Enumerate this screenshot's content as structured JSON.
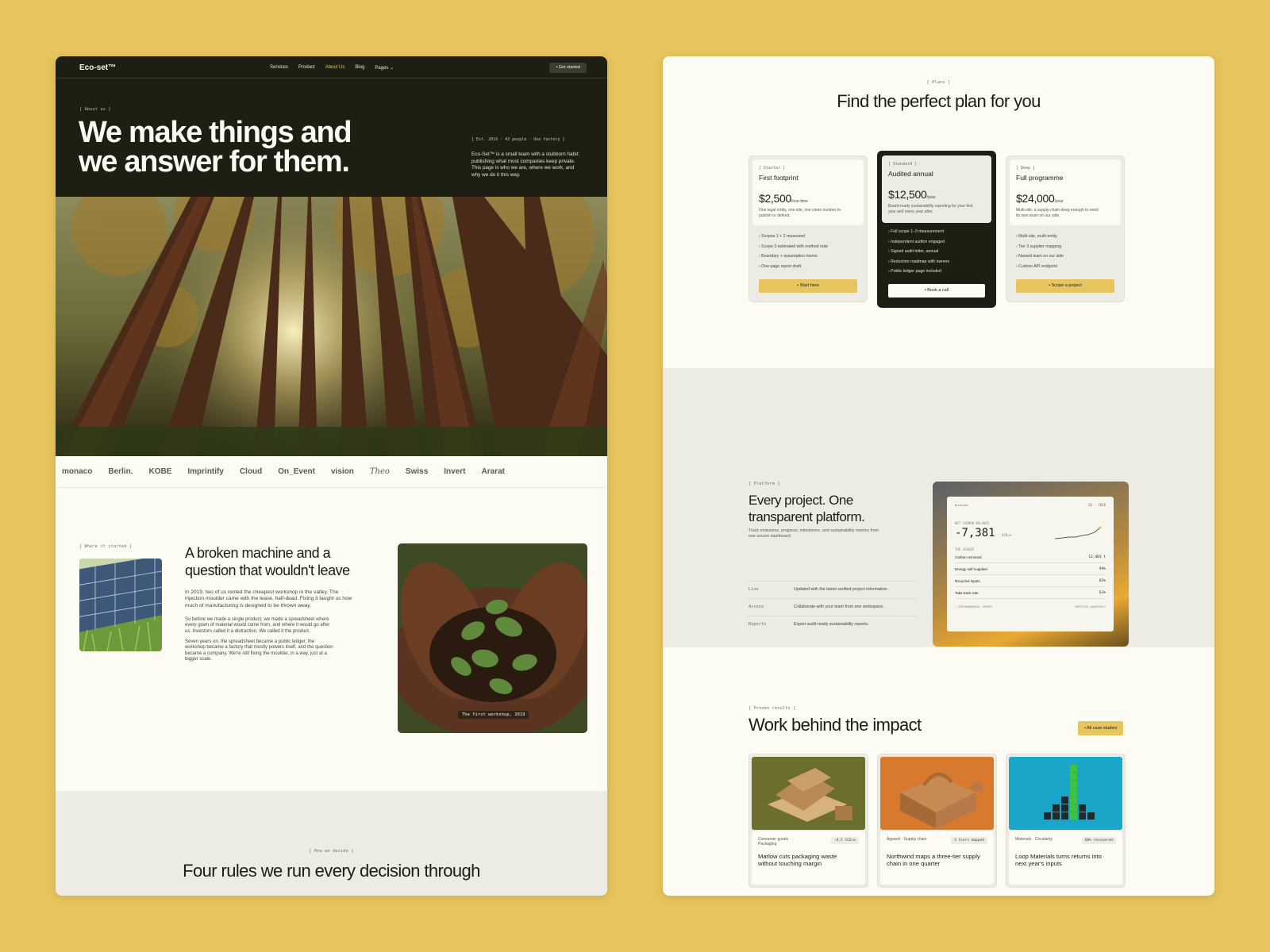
{
  "brand": {
    "accent": "#e7c45e",
    "dark": "#1d1f12",
    "cream": "#fcfbf4",
    "stone": "#ecebe4"
  },
  "left": {
    "nav": {
      "logo": "Eco-set™",
      "links": [
        "Services",
        "Product",
        "About Us",
        "Blog",
        "Pages ⌄"
      ],
      "active": "About Us",
      "cta": "• Get started"
    },
    "hero": {
      "eyebrow": "[ About us ]",
      "title": "We make things and we answer for them.",
      "meta": "[ Est. 2019 · 43 people · One factory ]",
      "description": "Eco-Set™ is a small team with a stubborn habit: publishing what most companies keep private. This page is who we are, where we work, and why we do it this way."
    },
    "logos": [
      "monaco",
      "Berlin.",
      "KOBE",
      "Imprintify",
      "Cloud",
      "On_Event",
      "vision",
      "Theo",
      "Swiss",
      "Invert",
      "Ararat"
    ],
    "story": {
      "eyebrow": "[ Where it started ]",
      "title": "A broken machine and a question that wouldn't leave",
      "p1": "In 2019, two of us rented the cheapest workshop in the valley. The injection moulder came with the lease, half-dead. Fixing it taught us how much of manufacturing is designed to be thrown away.",
      "p2": "So before we made a single product, we made a spreadsheet where every gram of material would come from, and where it would go after us. Investors called it a distraction. We called it the product.",
      "p3": "Seven years on, the spreadsheet became a public ledger, the workshop became a factory that mostly powers itself, and the question became a company. We're still fixing the moulder, in a way, just at a bigger scale.",
      "photo_caption": "The first workshop, 2019"
    },
    "rules": {
      "eyebrow": "[ How we decide ]",
      "title": "Four rules we run every decision through"
    }
  },
  "right": {
    "plans": {
      "eyebrow": "[ Plans ]",
      "title": "Find the perfect plan for you",
      "items": [
        {
          "tag": "[ Starter ]",
          "name": "First footprint",
          "price": "$2,500",
          "unit": "/one-time",
          "desc": "One legal entity, one site, one clean number to publish or defend.",
          "features": [
            "› Scopes 1 + 2 measured",
            "› Scope 3 estimated with method note",
            "› Boundary + assumption memo",
            "› One-page report draft"
          ],
          "cta": "• Start here"
        },
        {
          "tag": "[ Standard ]",
          "name": "Audited annual",
          "price": "$12,500",
          "unit": "/year",
          "desc": "Board-ready sustainability reporting for your first year and every year after.",
          "features": [
            "› Full scope 1–3 measurement",
            "› Independent auditor engaged",
            "› Signed audit letter, annual",
            "› Reduction roadmap with owners",
            "› Public ledger page included"
          ],
          "cta": "• Book a call"
        },
        {
          "tag": "[ Deep ]",
          "name": "Full programme",
          "price": "$24,000",
          "unit": "/year",
          "desc": "Multi-site, a supply-chain deep enough to need its own team on our side.",
          "features": [
            "› Multi-site, multi-entity",
            "› Tier 3 supplier mapping",
            "› Named team on our side",
            "› Custom API endpoint"
          ],
          "cta": "• Scope a project"
        }
      ]
    },
    "platform": {
      "eyebrow": "[ Platform ]",
      "title": "Every project. One transparent platform.",
      "subtitle": "Track emissions, progress, milestones, and sustainability metrics from one secure dashboard.",
      "rows": [
        {
          "key": "Live",
          "value": "Updated with the latest verified project information."
        },
        {
          "key": "Access",
          "value": "Collaborate with your team from one workspace."
        },
        {
          "key": "Reports",
          "value": "Export audit-ready sustainability reports."
        }
      ],
      "dashboard": {
        "brand": "● eco-set",
        "period": "Q1 · 2026",
        "label": "NET CARBON BALANCE",
        "value": "-7,381",
        "unit": "tCO₂e",
        "ledger_label": "THE LEDGER",
        "ledger": [
          {
            "name": "Carbon removed",
            "value": "12,403 t"
          },
          {
            "name": "Energy self-supplied",
            "value": "94%"
          },
          {
            "name": "Recycled inputs",
            "value": "82%"
          },
          {
            "name": "Take-back rate",
            "value": "61%"
          }
        ],
        "footer_left": "— ENVIRONMENTAL REPORT",
        "footer_right": "VERIFIED QUARTERLY"
      }
    },
    "work": {
      "eyebrow": "[ Proven results ]",
      "title": "Work behind the impact",
      "cta": "• All case studies",
      "cases": [
        {
          "category": "Consumer goods · Packaging",
          "badge": "−4.2 tCO₂e",
          "title": "Marlow cuts packaging waste without touching margin"
        },
        {
          "category": "Apparel · Supply chain",
          "badge": "3 tiers mapped",
          "title": "Northwind maps a three-tier supply chain in one quarter"
        },
        {
          "category": "Materials · Circularity",
          "badge": "60% recovered",
          "title": "Loop Materials turns returns into next year's inputs"
        }
      ]
    }
  }
}
